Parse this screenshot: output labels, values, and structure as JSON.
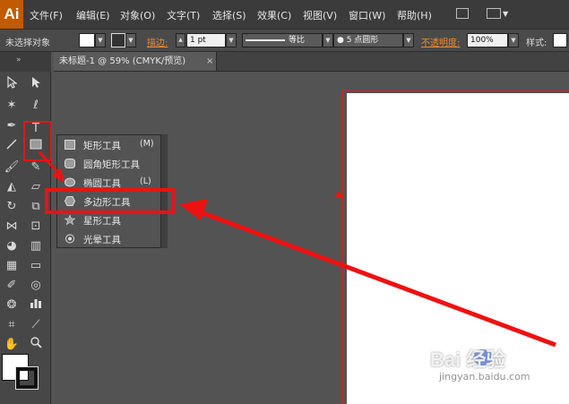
{
  "app": {
    "logo": "Ai",
    "accent": "#c25a00",
    "menus": [
      "文件(F)",
      "编辑(E)",
      "对象(O)",
      "文字(T)",
      "选择(S)",
      "效果(C)",
      "视图(V)",
      "窗口(W)",
      "帮助(H)"
    ]
  },
  "control_bar": {
    "selection": "未选择对象",
    "stroke_label": "描边:",
    "stroke_weight": "1 pt",
    "stroke_profile": "等比",
    "brush": "5 点圆形",
    "opacity_label": "不透明度:",
    "opacity_value": "100%",
    "style_label": "样式:"
  },
  "document": {
    "tab_title": "未标题-1 @ 59% (CMYK/预览)",
    "close_glyph": "×"
  },
  "toolbox": {
    "type_tool_glyph": "T",
    "fill_color": "#ffffff",
    "stroke_color": "#111111"
  },
  "flyout": {
    "items": [
      {
        "label": "矩形工具",
        "shortcut": "(M)",
        "icon": "rectangle-icon"
      },
      {
        "label": "圆角矩形工具",
        "shortcut": "",
        "icon": "rounded-rectangle-icon"
      },
      {
        "label": "椭圆工具",
        "shortcut": "(L)",
        "icon": "ellipse-icon"
      },
      {
        "label": "多边形工具",
        "shortcut": "",
        "icon": "polygon-icon"
      },
      {
        "label": "星形工具",
        "shortcut": "",
        "icon": "star-icon"
      },
      {
        "label": "光晕工具",
        "shortcut": "",
        "icon": "flare-icon"
      }
    ],
    "highlighted": "多边形工具"
  },
  "annotation": {
    "color": "#ee1111"
  },
  "watermark": {
    "brand": "Bai  经验",
    "url": "jingyan.baidu.com"
  }
}
